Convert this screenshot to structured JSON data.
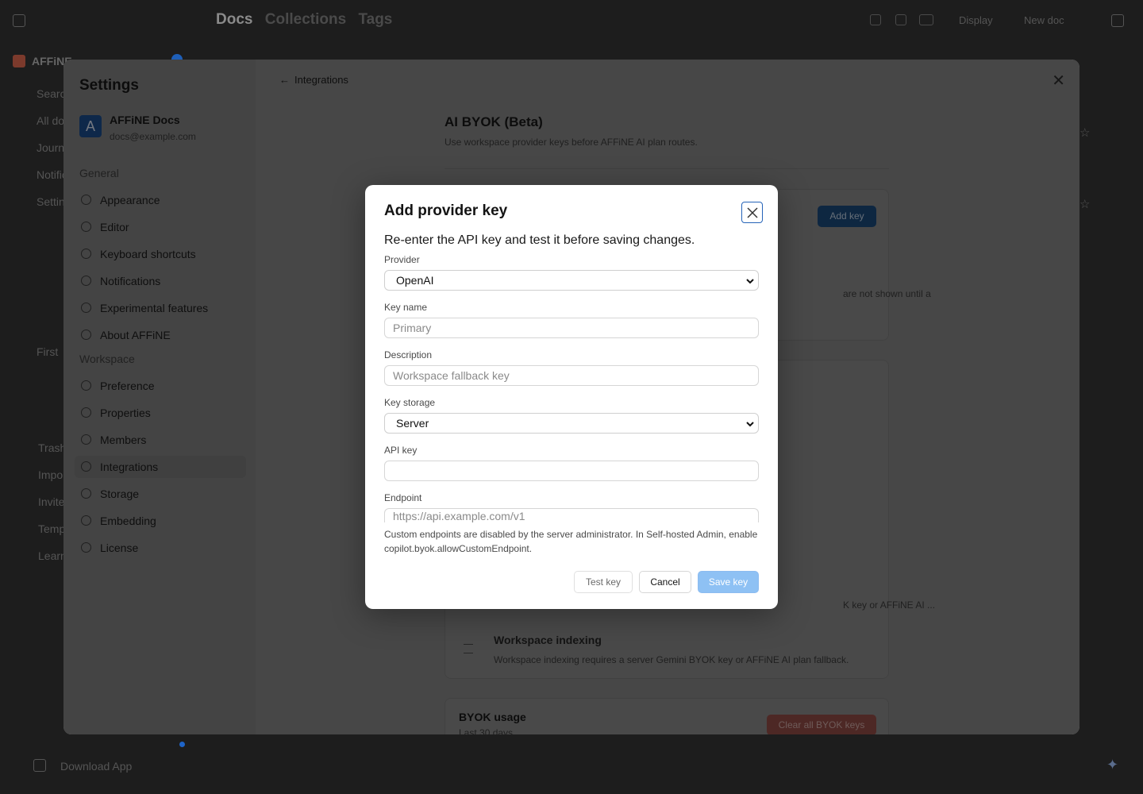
{
  "app": {
    "tabs": [
      "Docs",
      "Collections",
      "Tags"
    ],
    "display_label": "Display",
    "new_doc_label": "New doc",
    "workspace_name": "AFFiNE",
    "sidebar_items": [
      "Search",
      "All docs",
      "Journals",
      "Notifications",
      "Settings"
    ],
    "sidebar_lower": [
      "First",
      "Trash",
      "Import",
      "Invite",
      "Templates",
      "Learn"
    ],
    "download_label": "Download App"
  },
  "settings": {
    "title": "Settings",
    "account": {
      "avatar_letter": "A",
      "name": "AFFiNE Docs",
      "email": "docs@example.com"
    },
    "groups": {
      "general": "General",
      "workspace": "Workspace"
    },
    "general_items": [
      "Appearance",
      "Editor",
      "Keyboard shortcuts",
      "Notifications",
      "Experimental features",
      "About AFFiNE"
    ],
    "workspace_items": [
      "Preference",
      "Properties",
      "Members",
      "Integrations",
      "Storage",
      "Embedding",
      "License"
    ],
    "selected_item": "Integrations",
    "breadcrumb": "Integrations",
    "page_title": "AI BYOK (Beta)",
    "page_subtitle": "Use workspace provider keys before AFFiNE AI plan routes.",
    "add_key_label": "Add key",
    "fragment_not_shown": "are not shown until a",
    "fragment_byok": "K key or AFFiNE AI ...",
    "indexing_title": "Workspace indexing",
    "indexing_desc": "Workspace indexing requires a server Gemini BYOK key or AFFiNE AI plan fallback.",
    "usage_title": "BYOK usage",
    "usage_sub": "Last 30 days",
    "clear_label": "Clear all BYOK keys"
  },
  "modal": {
    "title": "Add provider key",
    "description": "Re-enter the API key and test it before saving changes.",
    "provider": {
      "label": "Provider",
      "value": "OpenAI"
    },
    "key_name": {
      "label": "Key name",
      "placeholder": "Primary",
      "value": ""
    },
    "desc_field": {
      "label": "Description",
      "placeholder": "Workspace fallback key",
      "value": ""
    },
    "key_storage": {
      "label": "Key storage",
      "value": "Server"
    },
    "api_key": {
      "label": "API key",
      "placeholder": "",
      "value": ""
    },
    "endpoint": {
      "label": "Endpoint",
      "placeholder": "https://api.example.com/v1",
      "value": ""
    },
    "endpoint_note": "Custom endpoints are disabled by the server administrator. In Self-hosted Admin, enable copilot.byok.allowCustomEndpoint.",
    "buttons": {
      "test": "Test key",
      "cancel": "Cancel",
      "save": "Save key"
    }
  },
  "colors": {
    "accent": "#2563b8",
    "save_disabled": "#8ec1f4",
    "add_key": "#1b4777",
    "danger": "#8c4a44"
  }
}
